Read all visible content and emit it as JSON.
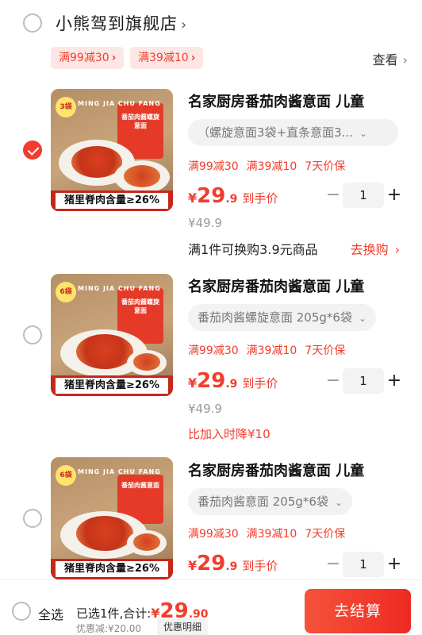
{
  "store": {
    "name": "小熊驾到旗舰店",
    "chevron": "›",
    "coupons": [
      {
        "label": "满99减30",
        "arrow": "›"
      },
      {
        "label": "满39减10",
        "arrow": "›"
      }
    ],
    "view_link": "查看",
    "view_arrow": "›"
  },
  "items": [
    {
      "checked": true,
      "title": "名家厨房番茄肉酱意面 儿童",
      "spec": "（螺旋意面3袋+直条意面3...",
      "spec_icon": "chevron-down-icon",
      "promos": [
        "满99减30",
        "满39减10",
        "7天价保"
      ],
      "price_currency": "¥",
      "price_int": "29",
      "price_dec": ".9",
      "price_label": "到手价",
      "orig_price": "¥49.9",
      "qty": "1",
      "minus": "−",
      "plus": "+",
      "redeem_text": "满1件可换购3.9元商品",
      "redeem_link": "去换购",
      "redeem_arrow": "›",
      "thumb": {
        "count": "3袋",
        "brand": "MING JIA CHU FANG",
        "box_label": "番茄肉酱螺旋意面",
        "banner": "猪里脊肉含量≥26%"
      }
    },
    {
      "checked": false,
      "title": "名家厨房番茄肉酱意面 儿童",
      "spec": "番茄肉酱螺旋意面 205g*6袋",
      "spec_icon": "chevron-down-icon",
      "promos": [
        "满99减30",
        "满39减10",
        "7天价保"
      ],
      "price_currency": "¥",
      "price_int": "29",
      "price_dec": ".9",
      "price_label": "到手价",
      "orig_price": "¥49.9",
      "qty": "1",
      "minus": "−",
      "plus": "+",
      "drop_note": "比加入时降¥10",
      "thumb": {
        "count": "6袋",
        "brand": "MING JIA CHU FANG",
        "box_label": "番茄肉酱螺旋意面",
        "banner": "猪里脊肉含量≥26%"
      }
    },
    {
      "checked": false,
      "title": "名家厨房番茄肉酱意面 儿童",
      "spec": "番茄肉酱意面 205g*6袋",
      "spec_icon": "chevron-down-icon",
      "promos": [
        "满99减30",
        "满39减10",
        "7天价保"
      ],
      "price_currency": "¥",
      "price_int": "29",
      "price_dec": ".9",
      "price_label": "到手价",
      "qty": "1",
      "minus": "−",
      "plus": "+",
      "thumb": {
        "count": "6袋",
        "brand": "MING JIA CHU FANG",
        "box_label": "番茄肉酱意面",
        "banner": "猪里脊肉含量≥26%"
      }
    }
  ],
  "footer": {
    "select_all": "全选",
    "selected_text": "已选1件,合计:",
    "total_currency": "¥",
    "total_int": "29",
    "total_dec": ".90",
    "discount_text": "优惠减:¥20.00",
    "detail_button": "优惠明细",
    "checkout_button": "去结算"
  },
  "colors": {
    "accent": "#f23d2c",
    "background": "#ffffff"
  }
}
